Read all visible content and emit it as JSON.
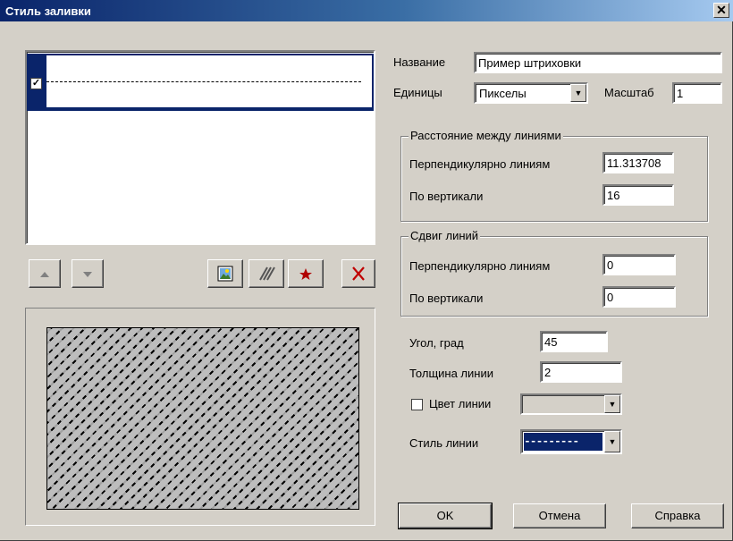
{
  "window": {
    "title": "Стиль заливки",
    "close_glyph": "✕"
  },
  "pattern_list": {
    "items": [
      {
        "checked": true,
        "pattern": "dashed-line"
      }
    ]
  },
  "list_toolbar": {
    "move_up_icon": "arrow-up-icon",
    "move_down_icon": "arrow-down-icon",
    "image_icon": "image-icon",
    "hatch_icon": "hatch-icon",
    "star_icon": "star-icon",
    "delete_icon": "delete-icon"
  },
  "form": {
    "name_label": "Название",
    "name_value": "Пример штриховки",
    "units_label": "Единицы",
    "units_value": "Пикселы",
    "scale_label": "Масштаб",
    "scale_value": "1"
  },
  "spacing_group": {
    "title": "Расстояние между линиями",
    "perp_label": "Перпендикулярно линиям",
    "perp_value": "11.313708",
    "vert_label": "По вертикали",
    "vert_value": "16"
  },
  "offset_group": {
    "title": "Сдвиг линий",
    "perp_label": "Перпендикулярно линиям",
    "perp_value": "0",
    "vert_label": "По вертикали",
    "vert_value": "0"
  },
  "line_props": {
    "angle_label": "Угол, град",
    "angle_value": "45",
    "width_label": "Толщина линии",
    "width_value": "2",
    "color_label": "Цвет линии",
    "color_checked": false,
    "style_label": "Стиль линии",
    "style_value": "---------"
  },
  "buttons": {
    "ok": "OK",
    "cancel": "Отмена",
    "help": "Справка"
  },
  "colors": {
    "selection": "#0a246a",
    "face": "#d4d0c8",
    "delete": "#c00000",
    "star": "#b00000"
  }
}
